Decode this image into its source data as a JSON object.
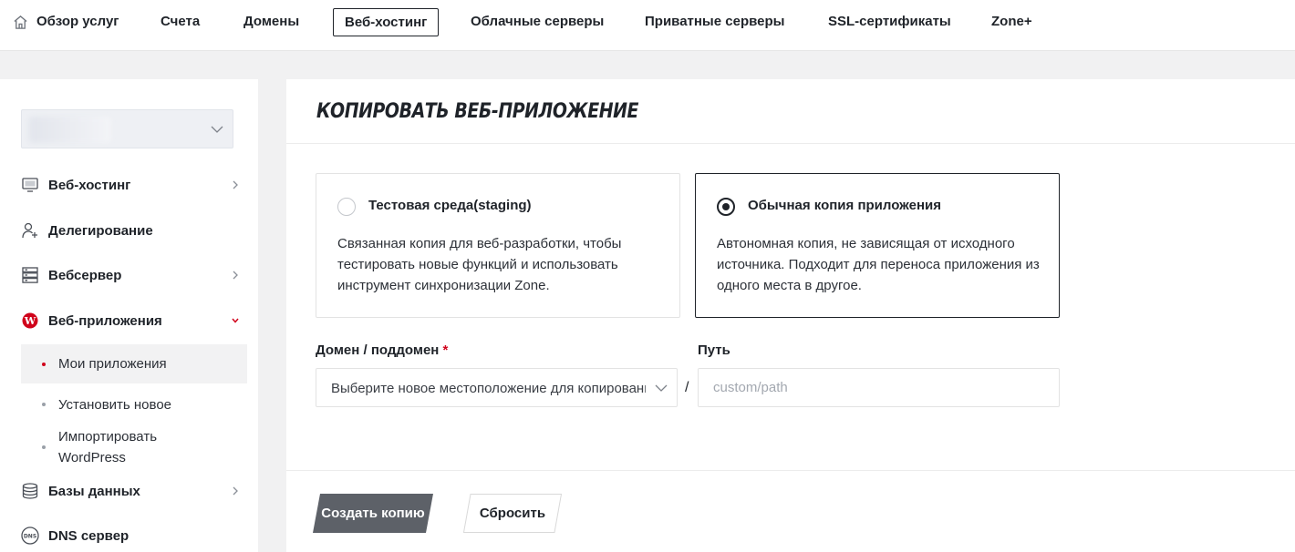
{
  "topnav": {
    "home_label": "Обзор услуг",
    "items": [
      "Счета",
      "Домены",
      "Веб-хостинг",
      "Облачные серверы",
      "Приватные серверы",
      "SSL-сертификаты",
      "Zone+"
    ],
    "active": "Веб-хостинг"
  },
  "sidebar": {
    "account_select": {
      "value": ""
    },
    "items": [
      {
        "label": "Веб-хостинг",
        "icon": "monitor-icon",
        "has_arrow": true
      },
      {
        "label": "Делегирование",
        "icon": "user-plus-icon",
        "has_arrow": false
      },
      {
        "label": "Вебсервер",
        "icon": "server-icon",
        "has_arrow": true
      },
      {
        "label": "Веб-приложения",
        "icon": "wordpress-icon",
        "has_arrow": true,
        "expanded": true
      },
      {
        "label": "Базы данных",
        "icon": "database-icon",
        "has_arrow": true
      },
      {
        "label": "DNS сервер",
        "icon": "dns-icon",
        "has_arrow": false
      }
    ],
    "subitems": [
      {
        "label": "Мои приложения",
        "active": true
      },
      {
        "label": "Установить новое",
        "active": false
      },
      {
        "label": "Импортировать WordPress",
        "active": false
      }
    ]
  },
  "main": {
    "title": "КОПИРОВАТЬ ВЕБ-ПРИЛОЖЕНИЕ",
    "options": [
      {
        "title": "Тестовая среда(staging)",
        "description": "Связанная копия для веб-разработки, чтобы тестировать новые функций и использовать инструмент синхронизации Zone.",
        "selected": false
      },
      {
        "title": "Обычная копия приложения",
        "description": "Автономная копия, не зависящая от исходного источника. Подходит для переноса приложения из одного места в другое.",
        "selected": true
      }
    ],
    "domain_label": "Домен / поддомен",
    "domain_required_mark": "*",
    "domain_placeholder": "Выберите новое местоположение для копирования",
    "separator": "/",
    "path_label": "Путь",
    "path_placeholder": "custom/path",
    "create_button": "Создать копию",
    "reset_button": "Сбросить"
  },
  "colors": {
    "accent_red": "#d0021b",
    "primary_button": "#5d6168",
    "text": "#1f2329"
  }
}
